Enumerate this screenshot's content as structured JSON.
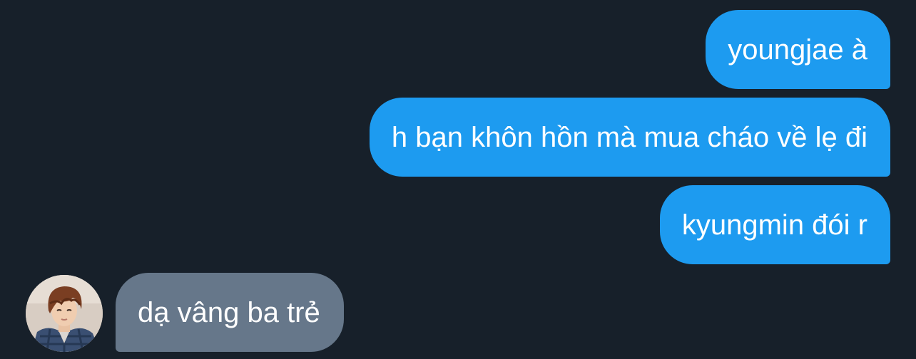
{
  "conversation": {
    "messages": [
      {
        "direction": "sent",
        "text": "youngjae à"
      },
      {
        "direction": "sent",
        "text": "h bạn khôn hồn mà mua cháo về lẹ đi"
      },
      {
        "direction": "sent",
        "text": "kyungmin đói r"
      },
      {
        "direction": "received",
        "text": "dạ vâng ba trẻ"
      }
    ],
    "colors": {
      "background": "#17202a",
      "sent_bubble": "#1d9bf0",
      "received_bubble": "#66778a",
      "text": "#ffffff"
    },
    "received_avatar_icon": "user-profile-photo"
  }
}
